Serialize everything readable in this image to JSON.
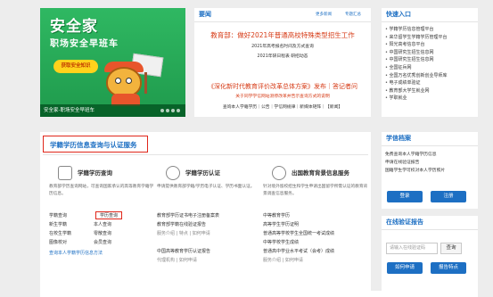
{
  "banner": {
    "brand": "安全家",
    "subtitle": "职场安全早班车",
    "button": "获取安全知识",
    "caption": "安全家-职场安全早班车"
  },
  "news": {
    "title": "要闻",
    "more": "更多新闻",
    "topics": "专题汇总",
    "headline": "教育部：做好2021年普通高校特殊类型招生工作",
    "lines": [
      "2021年高考报名时间及方式查询",
      "2021年研日程表 研招动态"
    ],
    "headline2": "《深化新时代教育评价改革总体方案》发布｜答记者问",
    "line_red": "关于同学学信网站测停改革并告示查询方式的说明",
    "line_footer": "查询本人学籍学历｜公告｜学信网规律｜新媒体矩阵｜【新闻】"
  },
  "quick": {
    "title": "快速入口",
    "items": [
      "学籍学历信息管理平台",
      "来华留学生学籍学历管理平台",
      "阳光高考信息平台",
      "中国研究生招生信息网",
      "中国研究生招生信息网",
      "全国征兵网",
      "全国万名优秀创新创业导师库",
      "电子成绩单验证",
      "教育部大学生就业网",
      "学职就业"
    ]
  },
  "main": {
    "title": "学籍学历信息查询与认证服务",
    "cols": [
      {
        "name": "学籍学历查询",
        "desc": "教育部学历查询网站，可查询国家承认的高等教育学籍学历信息。",
        "links": [
          [
            "学籍查询",
            "学历查询"
          ],
          [
            "新生学籍",
            "本人查询"
          ],
          [
            "在校生学籍",
            "零散查询"
          ],
          [
            "图像校对",
            "会员查询"
          ]
        ],
        "footer": "查询本人学籍学历信息方法"
      },
      {
        "name": "学籍学历认证",
        "desc": "申请提供教育部学籍/学历电子认证、学历书面认证。",
        "links": [
          [
            "教育部学历证书电子注册备案表",
            ""
          ],
          [
            "教育部学籍在线验证报告",
            ""
          ],
          [
            "服务介绍 | 特点 | 如何申请",
            ""
          ],
          [
            "",
            ""
          ],
          [
            "中国高等教育学历认证报告",
            ""
          ],
          [
            "代理机构 | 如何申请",
            ""
          ]
        ],
        "footer": ""
      },
      {
        "name": "出国教育背景信息服务",
        "desc": "针对境外留校招生和学生申请出国留学所需认证的教育背景调查信息服务。",
        "links": [
          [
            "中等教育学历",
            ""
          ],
          [
            "高等学生学历证明",
            ""
          ],
          [
            "普通高等学校学生全国统一考试成绩",
            ""
          ],
          [
            "中等学校学生成绩",
            ""
          ],
          [
            "普通高中学业水平考试（会考）成绩",
            ""
          ],
          [
            "服务介绍 | 如何申请",
            ""
          ]
        ],
        "footer": ""
      }
    ]
  },
  "archive": {
    "title": "学信档案",
    "lines": [
      "免费查询本人学籍学历信息",
      "申请在线验证报告",
      "国籍学生学可校对本人学历照片"
    ],
    "login": "登录",
    "register": "注册"
  },
  "verify": {
    "title": "在线验证报告",
    "placeholder": "请输入在线验证码",
    "query": "查询",
    "apply": "如何申请",
    "features": "报告特点"
  }
}
